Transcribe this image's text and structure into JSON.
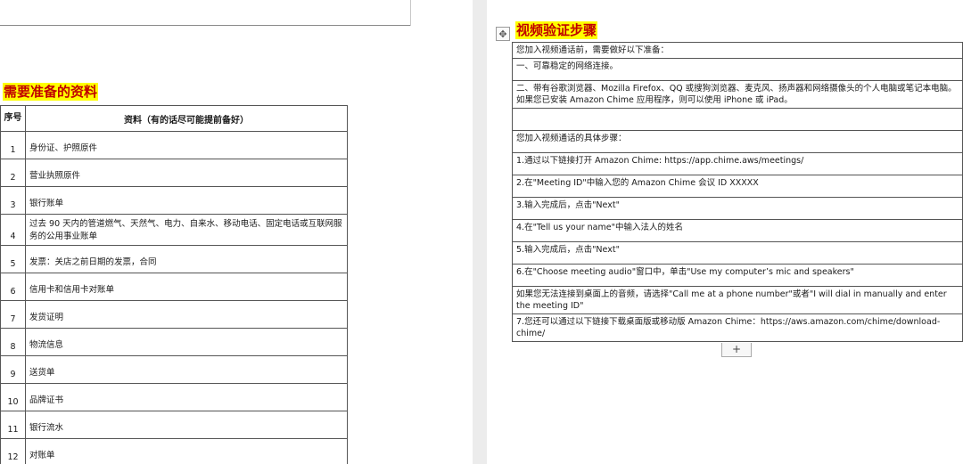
{
  "left_page": {
    "section_title": "需要准备的资料",
    "table": {
      "headers": {
        "seq": "序号",
        "item": "资料（有的话尽可能提前备好）"
      },
      "rows": [
        {
          "num": "1",
          "text": "身份证、护照原件"
        },
        {
          "num": "2",
          "text": "营业执照原件"
        },
        {
          "num": "3",
          "text": "银行账单"
        },
        {
          "num": "4",
          "text": "过去 90 天内的管道燃气、天然气、电力、自来水、移动电话、固定电话或互联网服务的公用事业账单"
        },
        {
          "num": "5",
          "text": "发票：关店之前日期的发票，合同"
        },
        {
          "num": "6",
          "text": "信用卡和信用卡对账单"
        },
        {
          "num": "7",
          "text": "发货证明"
        },
        {
          "num": "8",
          "text": "物流信息"
        },
        {
          "num": "9",
          "text": "送货单"
        },
        {
          "num": "10",
          "text": "品牌证书"
        },
        {
          "num": "11",
          "text": "银行流水"
        },
        {
          "num": "12",
          "text": "对账单"
        }
      ]
    }
  },
  "right_page": {
    "section_title": "视频验证步骤",
    "move_icon": "move-handle-icon",
    "add_row_label": "+",
    "rows": [
      "您加入视频通话前，需要做好以下准备：",
      "一、可靠稳定的网络连接。",
      "二、带有谷歌浏览器、Mozilla Firefox、QQ 或搜狗浏览器、麦克风、扬声器和网络摄像头的个人电脑或笔记本电脑。如果您已安装 Amazon Chime 应用程序，则可以使用 iPhone 或 iPad。",
      "",
      "您加入视频通话的具体步骤：",
      "1.通过以下链接打开 Amazon Chime: https://app.chime.aws/meetings/",
      "2.在\"Meeting ID\"中输入您的 Amazon Chime 会议 ID XXXXX",
      "3.输入完成后，点击\"Next\"",
      "4.在\"Tell us your name\"中输入法人的姓名",
      "5.输入完成后，点击\"Next\"",
      "6.在\"Choose meeting audio\"窗口中，单击\"Use my computer’s mic and speakers\"",
      "如果您无法连接到桌面上的音频，请选择\"Call me at a phone number\"或者\"I will dial in manually and enter the meeting ID\"",
      "7.您还可以通过以下链接下载桌面版或移动版 Amazon Chime：https://aws.amazon.com/chime/download-chime/"
    ]
  }
}
